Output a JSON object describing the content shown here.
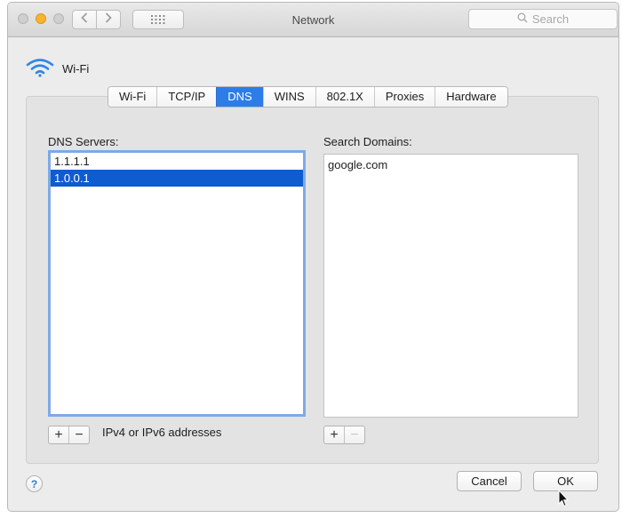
{
  "window": {
    "title": "Network",
    "search_placeholder": "Search"
  },
  "interface": {
    "name": "Wi-Fi"
  },
  "tabs": [
    {
      "label": "Wi-Fi"
    },
    {
      "label": "TCP/IP"
    },
    {
      "label": "DNS",
      "active": true
    },
    {
      "label": "WINS"
    },
    {
      "label": "802.1X"
    },
    {
      "label": "Proxies"
    },
    {
      "label": "Hardware"
    }
  ],
  "dns_servers": {
    "label": "DNS Servers:",
    "items": [
      "1.1.1.1",
      "1.0.0.1"
    ],
    "selected_index": 1,
    "hint": "IPv4 or IPv6 addresses"
  },
  "search_domains": {
    "label": "Search Domains:",
    "items": [
      "google.com"
    ]
  },
  "buttons": {
    "add": "+",
    "remove": "−",
    "help": "?",
    "cancel": "Cancel",
    "ok": "OK"
  },
  "colors": {
    "accent": "#2c7de8",
    "selection": "#0f5bd0",
    "focus_ring": "#7fa9e3",
    "wifi_icon": "#2f86e6"
  }
}
